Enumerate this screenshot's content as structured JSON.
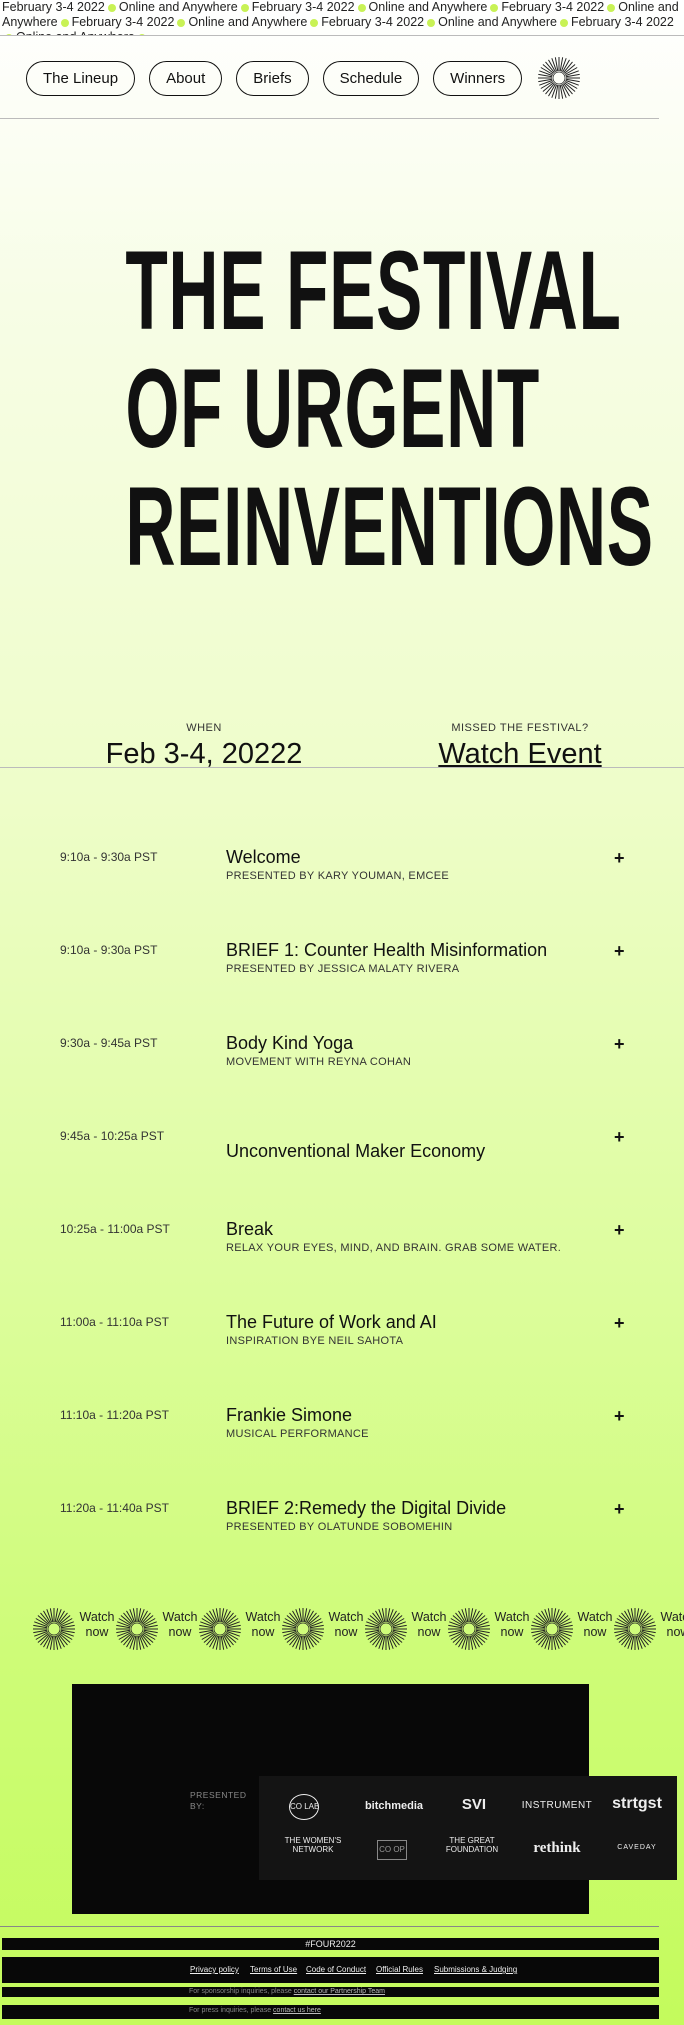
{
  "ticker": {
    "segments": [
      "February 3-4 2022",
      "Online and Anywhere",
      "February 3-4 2022",
      "Online and Anywhere",
      "February 3-4 2022",
      "Online and Anywhere",
      "February 3-4 2022",
      "Online and Anywhere",
      "February 3-4 2022",
      "Online and Anywhere",
      "February 3-4 2022",
      "Online and Anywhere"
    ],
    "dot_color": "#c8f255"
  },
  "nav": {
    "items": [
      "The Lineup",
      "About",
      "Briefs",
      "Schedule",
      "Winners"
    ],
    "logo_icon": "sunburst-icon"
  },
  "hero": {
    "lines": [
      "THE FESTIVAL",
      "OF URGENT",
      "REINVENTIONS"
    ]
  },
  "meta": {
    "when_label": "WHEN",
    "when_value": "Feb 3-4, 20222",
    "missed_label": "MISSED THE FESTIVAL?",
    "watch_link": "Watch Event"
  },
  "schedule": [
    {
      "time": "9:10a - 9:30a PST",
      "title": "Welcome",
      "sub": "PRESENTED BY KARY YOUMAN, EMCEE"
    },
    {
      "time": "9:10a - 9:30a PST",
      "title": "BRIEF 1: Counter Health Misinformation",
      "sub": "PRESENTED BY JESSICA MALATY RIVERA"
    },
    {
      "time": "9:30a - 9:45a PST",
      "title": "Body Kind Yoga",
      "sub": "MOVEMENT WITH REYNA COHAN"
    },
    {
      "time": "9:45a - 10:25a PST",
      "title": "Unconventional Maker Economy",
      "sub": ""
    },
    {
      "time": "10:25a - 11:00a PST",
      "title": "Break",
      "sub": "RELAX YOUR EYES, MIND, AND BRAIN. GRAB SOME WATER."
    },
    {
      "time": "11:00a - 11:10a PST",
      "title": "The Future of Work and AI",
      "sub": "INSPIRATION BYE NEIL SAHOTA"
    },
    {
      "time": "11:10a - 11:20a PST",
      "title": "Frankie Simone",
      "sub": "MUSICAL PERFORMANCE"
    },
    {
      "time": "11:20a - 11:40a PST",
      "title": "BRIEF 2:Remedy the Digital Divide",
      "sub": "PRESENTED BY OLATUNDE SOBOMEHIN"
    }
  ],
  "expand_symbol": "+",
  "watch_strip": {
    "label": "Watch now",
    "count": 8
  },
  "sponsors": {
    "presented_by": "PRESENTED BY:",
    "logos": [
      "CO LAB",
      "bitchmedia",
      "SVI",
      "INSTRUMENT",
      "strtgst",
      "THE WOMEN'S NETWORK",
      "CO OP",
      "THE GREAT FOUNDATION",
      "rethink",
      "CAVEDAY"
    ]
  },
  "footer": {
    "hashtag": "#FOUR2022",
    "links": [
      "Privacy policy",
      "Terms of Use",
      "Code of Conduct",
      "Official Rules",
      "Submissions & Judging"
    ],
    "sponsorship_text": "For sponsorship inquiries, please",
    "sponsorship_link": "contact our Partnership Team",
    "press_text": "For press inquiries, please",
    "press_link": "contact us here"
  },
  "colors": {
    "accent": "#c8f255",
    "ink": "#111111",
    "dark": "#080808"
  }
}
